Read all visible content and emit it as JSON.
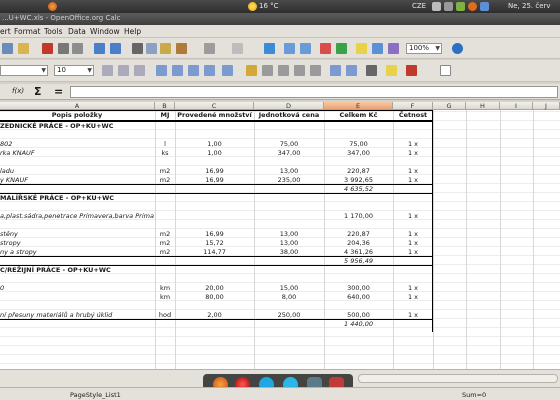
{
  "panel": {
    "weather": "16 °C",
    "keyboard": "CZE",
    "datetime": "Ne, 25. červ"
  },
  "window": {
    "title": "...U+WC.xls - OpenOffice.org Calc"
  },
  "menu": [
    "ert",
    "Format",
    "Tools",
    "Data",
    "Window",
    "Help"
  ],
  "toolbar": {
    "zoom": "100%",
    "font_size": "10"
  },
  "formula_bar": {
    "fx": "f(x)",
    "sum": "Σ",
    "equals": "="
  },
  "columns": [
    {
      "label": "A"
    },
    {
      "label": "B"
    },
    {
      "label": "C"
    },
    {
      "label": "D"
    },
    {
      "label": "E"
    },
    {
      "label": "F"
    },
    {
      "label": "G"
    },
    {
      "label": "H"
    },
    {
      "label": "I"
    },
    {
      "label": "J"
    }
  ],
  "table": {
    "header": [
      "Popis položky",
      "MJ",
      "Provedené množství",
      "Jednotková cena",
      "Celkem Kč",
      "Četnost"
    ],
    "rows": [
      {
        "a": "ZEDNICKÉ PRÁCE  - OP+KU+WC",
        "b": "",
        "c": "",
        "d": "",
        "e": "",
        "f": "",
        "style": "section"
      },
      {
        "a": "",
        "b": "",
        "c": "",
        "d": "",
        "e": "",
        "f": ""
      },
      {
        "a": "802",
        "b": "l",
        "c": "1,00",
        "d": "75,00",
        "e": "75,00",
        "f": "1 x",
        "style": "italic"
      },
      {
        "a": "rka KNAUF",
        "b": "ks",
        "c": "1,00",
        "d": "347,00",
        "e": "347,00",
        "f": "1 x",
        "style": "italic"
      },
      {
        "a": "",
        "b": "",
        "c": "",
        "d": "",
        "e": "",
        "f": ""
      },
      {
        "a": "ladu",
        "b": "m2",
        "c": "16,99",
        "d": "13,00",
        "e": "220,87",
        "f": "1 x",
        "style": "italic"
      },
      {
        "a": "y KNAUF",
        "b": "m2",
        "c": "16,99",
        "d": "235,00",
        "e": "3 992,65",
        "f": "1 x",
        "style": "italic"
      },
      {
        "a": "",
        "b": "",
        "c": "",
        "d": "",
        "e": "4 635,52",
        "f": "",
        "style": "total"
      },
      {
        "a": "MALÍŘSKÉ PRÁCE  - OP+KU+WC",
        "b": "",
        "c": "",
        "d": "",
        "e": "",
        "f": "",
        "style": "section"
      },
      {
        "a": "",
        "b": "",
        "c": "",
        "d": "",
        "e": "",
        "f": ""
      },
      {
        "a": "a,plast.sádra,penetrace Primavera,barva Primavera 0100",
        "b": "",
        "c": "",
        "d": "",
        "e": "1 170,00",
        "f": "1 x",
        "style": "italic"
      },
      {
        "a": "",
        "b": "",
        "c": "",
        "d": "",
        "e": "",
        "f": ""
      },
      {
        "a": "stěny",
        "b": "m2",
        "c": "16,99",
        "d": "13,00",
        "e": "220,87",
        "f": "1 x",
        "style": "italic"
      },
      {
        "a": "stropy",
        "b": "m2",
        "c": "15,72",
        "d": "13,00",
        "e": "204,36",
        "f": "1 x",
        "style": "italic"
      },
      {
        "a": "ny a stropy",
        "b": "m2",
        "c": "114,77",
        "d": "38,00",
        "e": "4 361,26",
        "f": "1 x",
        "style": "italic"
      },
      {
        "a": "",
        "b": "",
        "c": "",
        "d": "",
        "e": "5 956,49",
        "f": "",
        "style": "total"
      },
      {
        "a": "C/REŽIJNÍ PRÁCE - OP+KU+WC",
        "b": "",
        "c": "",
        "d": "",
        "e": "",
        "f": "",
        "style": "section"
      },
      {
        "a": "",
        "b": "",
        "c": "",
        "d": "",
        "e": "",
        "f": ""
      },
      {
        "a": "0",
        "b": "km",
        "c": "20,00",
        "d": "15,00",
        "e": "300,00",
        "f": "1 x",
        "style": "italic"
      },
      {
        "a": "",
        "b": "km",
        "c": "80,00",
        "d": "8,00",
        "e": "640,00",
        "f": "1 x",
        "style": "italic"
      },
      {
        "a": "",
        "b": "",
        "c": "",
        "d": "",
        "e": "",
        "f": ""
      },
      {
        "a": "ní přesuny materiálů a hrubý úklid",
        "b": "hod",
        "c": "2,00",
        "d": "250,00",
        "e": "500,00",
        "f": "1 x",
        "style": "italic"
      },
      {
        "a": "",
        "b": "",
        "c": "",
        "d": "",
        "e": "1 440,00",
        "f": "",
        "style": "total"
      }
    ]
  },
  "status": {
    "page_style": "PageStyle_List1",
    "sum": "Sum=0"
  },
  "colors": {
    "selected_col": "#e9a272",
    "panel": "#3a3a3a",
    "chrome": "#e4e1da"
  }
}
